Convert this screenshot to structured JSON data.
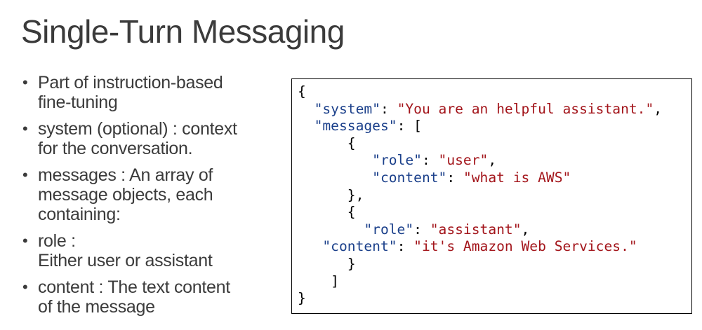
{
  "slide": {
    "title": "Single-Turn Messaging"
  },
  "bullets": [
    {
      "lines": [
        "Part of instruction-based",
        "fine-tuning"
      ]
    },
    {
      "lines": [
        "system (optional) : context",
        "for the conversation."
      ]
    },
    {
      "lines": [
        "messages : An array of",
        "message objects, each",
        "containing:"
      ]
    },
    {
      "lines": [
        "role :",
        "Either user or assistant"
      ]
    },
    {
      "lines": [
        "content : The text content",
        "of the message"
      ]
    }
  ],
  "code": {
    "open_brace": "{",
    "system_key": "\"system\"",
    "system_value": "\"You are an helpful assistant.\"",
    "messages_key": "\"messages\"",
    "msg1_role_key": "\"role\"",
    "msg1_role_value": "\"user\"",
    "msg1_content_key": "\"content\"",
    "msg1_content_value": "\"what is AWS\"",
    "msg2_role_key": "\"role\"",
    "msg2_role_value": "\"assistant\"",
    "msg2_content_key": "\"content\"",
    "msg2_content_value": "\"it's Amazon Web Services.\"",
    "close_brace": "}"
  },
  "colors": {
    "title_text": "#3b3b3b",
    "body_text": "#3b3b3b",
    "json_key": "#1a3f8a",
    "json_string": "#a3151b",
    "code_border": "#000000"
  }
}
